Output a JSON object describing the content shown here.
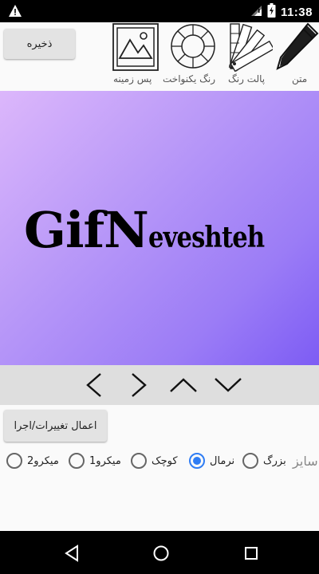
{
  "status_bar": {
    "time": "11:38",
    "icons": [
      "warning-icon",
      "wifi-icon",
      "battery-charging-icon"
    ]
  },
  "toolbar": {
    "save_label": "ذخیره",
    "tools": [
      {
        "name": "text",
        "label": "متن",
        "icon": "pencil-icon"
      },
      {
        "name": "palette",
        "label": "پالت رنگ",
        "icon": "color-swatch-icon"
      },
      {
        "name": "solid-color",
        "label": "رنگ یکنواخت",
        "icon": "color-wheel-icon"
      },
      {
        "name": "background",
        "label": "پس زمینه",
        "icon": "image-icon"
      }
    ]
  },
  "preview": {
    "text_large_1": "Gif",
    "text_large_2": "N",
    "text_small": "eveshteh",
    "gradient_start": "#dcb7fb",
    "gradient_end": "#7d5cf4"
  },
  "navigation": {
    "arrows": [
      "chevron-left-icon",
      "chevron-right-icon",
      "chevron-up-icon",
      "chevron-down-icon"
    ]
  },
  "options": {
    "apply_label": "اعمال تغییرات/اجرا",
    "size_label": "سایز:",
    "sizes": [
      {
        "label": "بزرگ",
        "checked": false
      },
      {
        "label": "نرمال",
        "checked": true
      },
      {
        "label": "کوچک",
        "checked": false
      },
      {
        "label": "میکرو1",
        "checked": false
      },
      {
        "label": "میکرو2",
        "checked": false
      }
    ],
    "accent_color": "#2f7df4"
  },
  "system_nav": {
    "buttons": [
      "back-icon",
      "home-icon",
      "recents-icon"
    ]
  }
}
